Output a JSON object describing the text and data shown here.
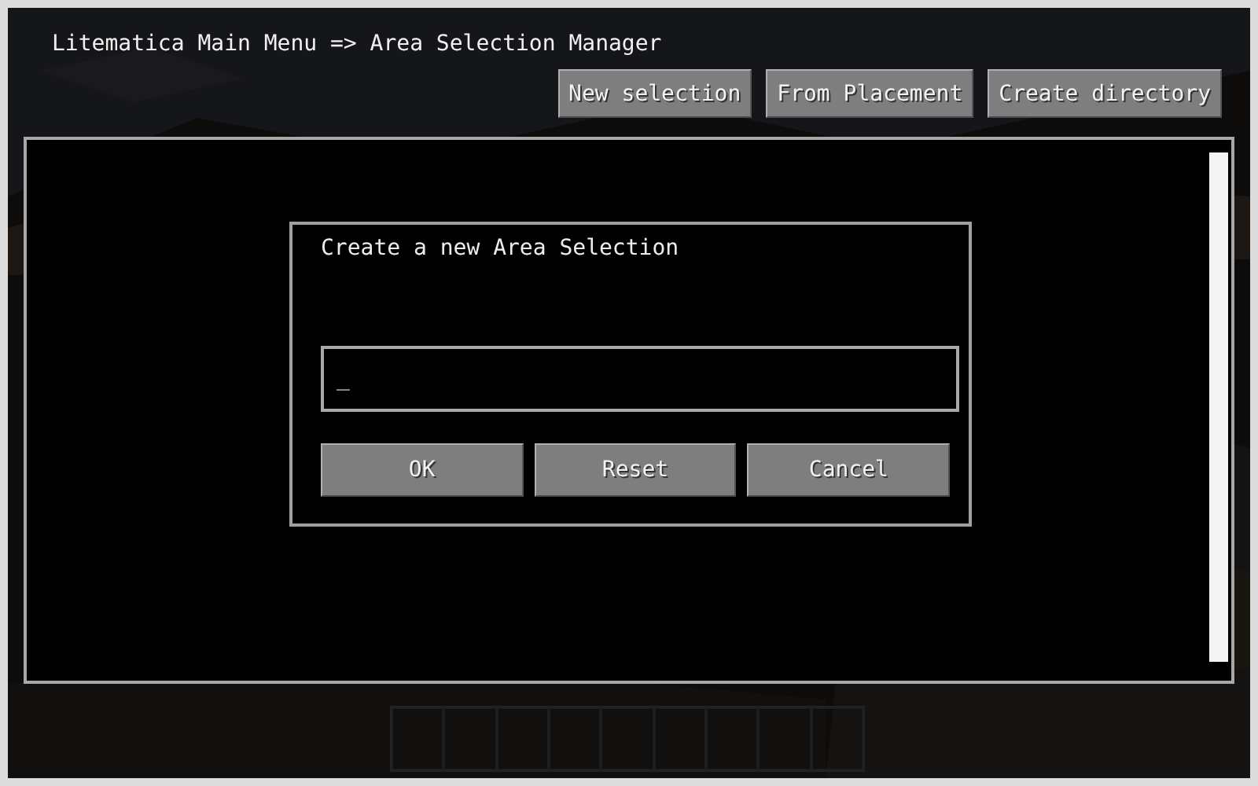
{
  "title": "Litematica Main Menu => Area Selection Manager",
  "toolbar_buttons": [
    "New selection",
    "From Placement",
    "Create directory"
  ],
  "dialog": {
    "title": "Create a new Area Selection",
    "name_field": {
      "value": "_"
    },
    "buttons": [
      "OK",
      "Reset",
      "Cancel"
    ]
  }
}
